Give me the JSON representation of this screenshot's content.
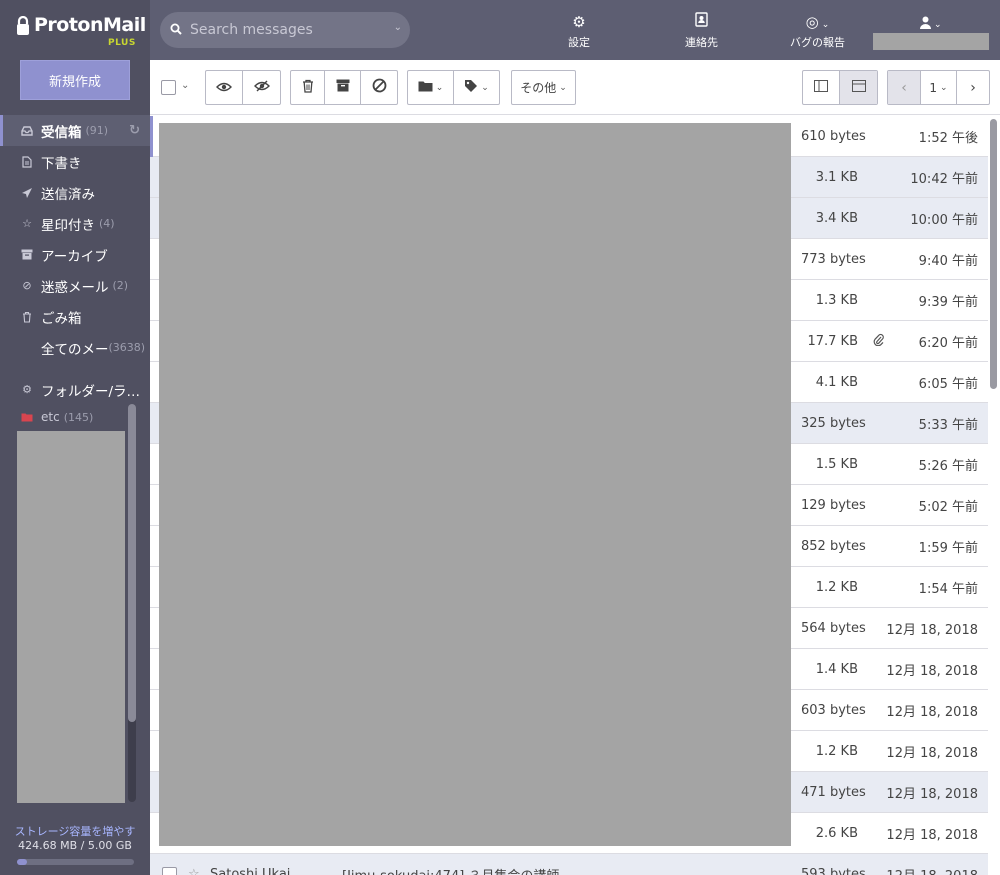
{
  "app": {
    "logo": "ProtonMail",
    "plan": "PLUS"
  },
  "sidebar": {
    "compose_label": "新規作成",
    "items": [
      {
        "label": "受信箱",
        "count": "(91)",
        "icon": "inbox-icon",
        "active": true
      },
      {
        "label": "下書き",
        "count": "",
        "icon": "draft-icon"
      },
      {
        "label": "送信済み",
        "count": "",
        "icon": "send-icon"
      },
      {
        "label": "星印付き",
        "count": "(4)",
        "icon": "star-icon"
      },
      {
        "label": "アーカイブ",
        "count": "",
        "icon": "archive-icon"
      },
      {
        "label": "迷惑メール",
        "count": "(2)",
        "icon": "spam-icon"
      },
      {
        "label": "ごみ箱",
        "count": "",
        "icon": "trash-icon"
      },
      {
        "label": "全てのメー",
        "count": "(3638)",
        "icon": ""
      }
    ],
    "folders_label": "フォルダー/ラ…",
    "folder_etc": {
      "label": "etc",
      "count": "(145)",
      "color": "#d9454f"
    },
    "storage_link": "ストレージ容量を増やす",
    "storage_usage": "424.68 MB / 5.00 GB",
    "storage_fraction": 0.085
  },
  "header": {
    "search_placeholder": "Search messages",
    "settings_label": "設定",
    "contacts_label": "連絡先",
    "bug_label": "バグの報告"
  },
  "toolbar": {
    "more_label": "その他",
    "page_number": "1"
  },
  "messages": [
    {
      "size": "610 bytes",
      "time": "1:52 午後",
      "read": false,
      "attachment": false
    },
    {
      "size": "3.1 KB",
      "time": "10:42 午前",
      "read": true,
      "attachment": false
    },
    {
      "size": "3.4 KB",
      "time": "10:00 午前",
      "read": true,
      "attachment": false
    },
    {
      "size": "773 bytes",
      "time": "9:40 午前",
      "read": false,
      "attachment": false
    },
    {
      "size": "1.3 KB",
      "time": "9:39 午前",
      "read": false,
      "attachment": false
    },
    {
      "size": "17.7 KB",
      "time": "6:20 午前",
      "read": false,
      "attachment": true
    },
    {
      "size": "4.1 KB",
      "time": "6:05 午前",
      "read": false,
      "attachment": false
    },
    {
      "size": "325 bytes",
      "time": "5:33 午前",
      "read": true,
      "attachment": false
    },
    {
      "size": "1.5 KB",
      "time": "5:26 午前",
      "read": false,
      "attachment": false
    },
    {
      "size": "129 bytes",
      "time": "5:02 午前",
      "read": false,
      "attachment": false
    },
    {
      "size": "852 bytes",
      "time": "1:59 午前",
      "read": false,
      "attachment": false
    },
    {
      "size": "1.2 KB",
      "time": "1:54 午前",
      "read": false,
      "attachment": false
    },
    {
      "size": "564 bytes",
      "time": "12月 18, 2018",
      "read": false,
      "attachment": false
    },
    {
      "size": "1.4 KB",
      "time": "12月 18, 2018",
      "read": false,
      "attachment": false
    },
    {
      "size": "603 bytes",
      "time": "12月 18, 2018",
      "read": false,
      "attachment": false
    },
    {
      "size": "1.2 KB",
      "time": "12月 18, 2018",
      "read": false,
      "attachment": false
    },
    {
      "size": "471 bytes",
      "time": "12月 18, 2018",
      "read": true,
      "attachment": false
    },
    {
      "size": "2.6 KB",
      "time": "12月 18, 2018",
      "read": false,
      "attachment": false
    },
    {
      "size": "593 bytes",
      "time": "12月 18, 2018",
      "read": true,
      "attachment": false,
      "from": "Satoshi Ukai",
      "subject": "[Jimu-sokudai:474] ３月集会の講師"
    }
  ]
}
